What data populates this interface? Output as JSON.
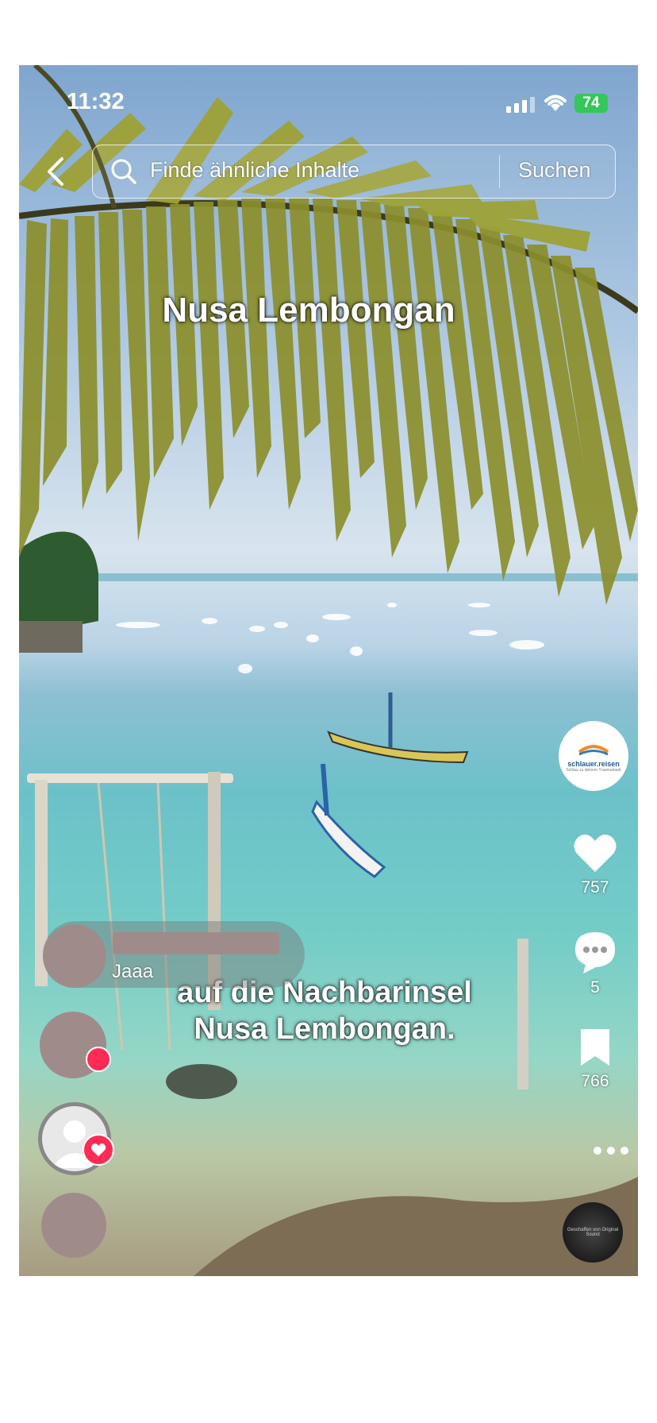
{
  "status_bar": {
    "time": "11:32",
    "battery": "74"
  },
  "search": {
    "placeholder": "Finde ähnliche Inhalte",
    "button_label": "Suchen"
  },
  "video": {
    "title_caption": "Nusa Lembongan",
    "subtitle_line1": "auf die Nachbarinsel",
    "subtitle_line2": "Nusa Lembongan."
  },
  "creator": {
    "logo_text": "schlauer.reisen",
    "logo_subtext": "Schlau zu deinem Traumurlaub"
  },
  "actions": {
    "likes": "757",
    "comments": "5",
    "saves": "766"
  },
  "comments": [
    {
      "text": "Jaaa"
    }
  ],
  "music": {
    "line1": "Geschaffen von Original",
    "line2": "Sound"
  },
  "colors": {
    "accent": "#fe2c55",
    "battery": "#34c759"
  }
}
